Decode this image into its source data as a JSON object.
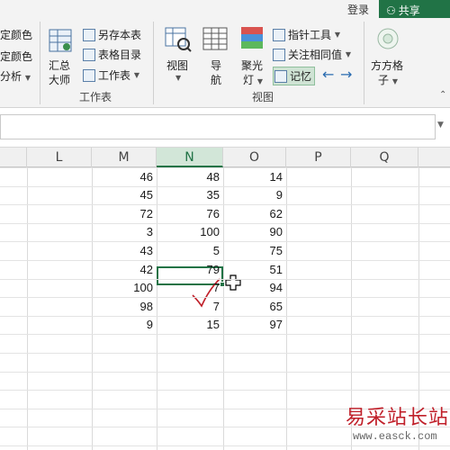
{
  "topbar": {
    "login": "登录",
    "share": "共享"
  },
  "ribbon": {
    "left_cut": {
      "item1": "定颜色",
      "item2": "定颜色",
      "item3": "分析"
    },
    "workbook_group": {
      "label": "工作表",
      "summary_master_line1": "汇总",
      "summary_master_line2": "大师",
      "save_as_table": "另存本表",
      "table_directory": "表格目录",
      "worksheet": "工作表"
    },
    "view_group": {
      "label": "视图",
      "view": "视图",
      "nav_line1": "导",
      "nav_line2": "航",
      "spotlight_line1": "聚光",
      "spotlight_line2": "灯",
      "pointer_tool": "指针工具",
      "follow_same": "关注相同值",
      "memory": "记忆"
    },
    "fangfang": {
      "line1": "方方格",
      "line2": "子"
    }
  },
  "columns": [
    "L",
    "M",
    "N",
    "O",
    "P",
    "Q"
  ],
  "selected_column": "N",
  "rows": [
    [
      "46",
      "48",
      "14"
    ],
    [
      "45",
      "35",
      "9"
    ],
    [
      "72",
      "76",
      "62"
    ],
    [
      "3",
      "100",
      "90"
    ],
    [
      "43",
      "5",
      "75"
    ],
    [
      "42",
      "79",
      "51"
    ],
    [
      "100",
      "7",
      "94"
    ],
    [
      "98",
      "7",
      "65"
    ],
    [
      "9",
      "15",
      "97"
    ]
  ],
  "active_cell_value": "7",
  "watermark": {
    "text": "易采站长站",
    "url": "www.easck.com"
  }
}
